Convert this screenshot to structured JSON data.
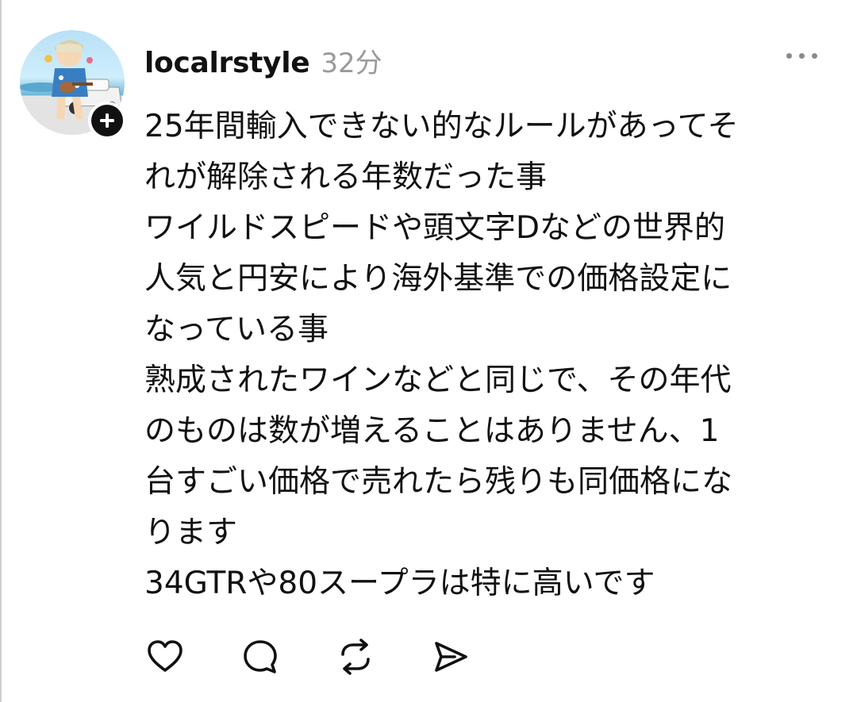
{
  "post": {
    "username": "localrstyle",
    "timestamp": "32分",
    "body_lines": [
      "25年間輸入できない的なルールがあってそ",
      "れが解除される年数だった事",
      "ワイルドスピードや頭文字Dなどの世界的",
      "人気と円安により海外基準での価格設定に",
      "なっている事",
      "熟成されたワインなどと同じで、その年代",
      "のものは数が増えることはありません、1",
      "台すごい価格で売れたら残りも同価格にな",
      "ります",
      "34GTRや80スープラは特に高いです"
    ]
  },
  "icons": {
    "follow": "plus-icon",
    "more": "more-horizontal-icon",
    "like": "heart-icon",
    "reply": "comment-bubble-icon",
    "repost": "repost-arrows-icon",
    "share": "send-icon"
  },
  "colors": {
    "text": "#111111",
    "muted": "#9a9a9a",
    "background": "#ffffff"
  }
}
